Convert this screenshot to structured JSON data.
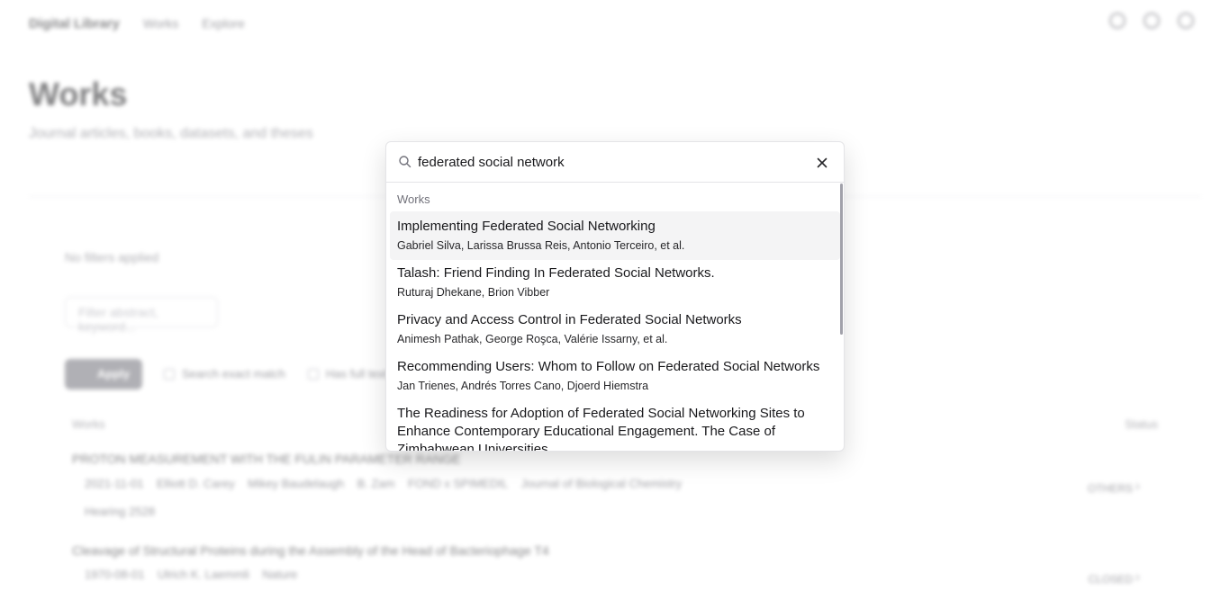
{
  "background": {
    "logo": "Digital Library",
    "nav": [
      "Works",
      "Explore"
    ],
    "title": "Works",
    "subtitle": "Journal articles, books, datasets, and theses",
    "filters_label": "No filters applied",
    "filter_placeholder": "Filter abstract, keyword...",
    "apply_label": "Apply",
    "checkboxes": [
      "Search exact match",
      "Has full text"
    ],
    "table_headers": {
      "left": "Works",
      "right": "Status"
    },
    "rows": [
      {
        "title": "PROTON MEASUREMENT WITH THE FULIN PARAMETER RANGE",
        "meta": [
          "2021-11-01",
          "Elliott D. Carey",
          "Mikey Baudelaugh",
          "B. Zam",
          "FOND x SPIMEDIL",
          "Journal of Biological Chemistry"
        ],
        "extra": "Hearing 2528",
        "status": "OTHERS"
      },
      {
        "title": "Cleavage of Structural Proteins during the Assembly of the Head of Bacteriophage T4",
        "meta": [
          "1970-08-01",
          "Ulrich K. Laemmli",
          "Nature"
        ],
        "status": "CLOSED"
      }
    ]
  },
  "search": {
    "query": "federated social network",
    "group_label": "Works",
    "results": [
      {
        "title": "Implementing Federated Social Networking",
        "authors": "Gabriel Silva, Larissa Brussa Reis, Antonio Terceiro, et al."
      },
      {
        "title": "Talash: Friend Finding In Federated Social Networks.",
        "authors": "Ruturaj Dhekane, Brion Vibber"
      },
      {
        "title": "Privacy and Access Control in Federated Social Networks",
        "authors": "Animesh Pathak, George Roşca, Valérie Issarny, et al."
      },
      {
        "title": "Recommending Users: Whom to Follow on Federated Social Networks",
        "authors": "Jan Trienes, Andrés Torres Cano, Djoerd Hiemstra"
      },
      {
        "title": "The Readiness for Adoption of Federated Social Networking Sites to Enhance Contemporary Educational Engagement. The Case of Zimbabwean Universities",
        "authors": ""
      }
    ]
  }
}
